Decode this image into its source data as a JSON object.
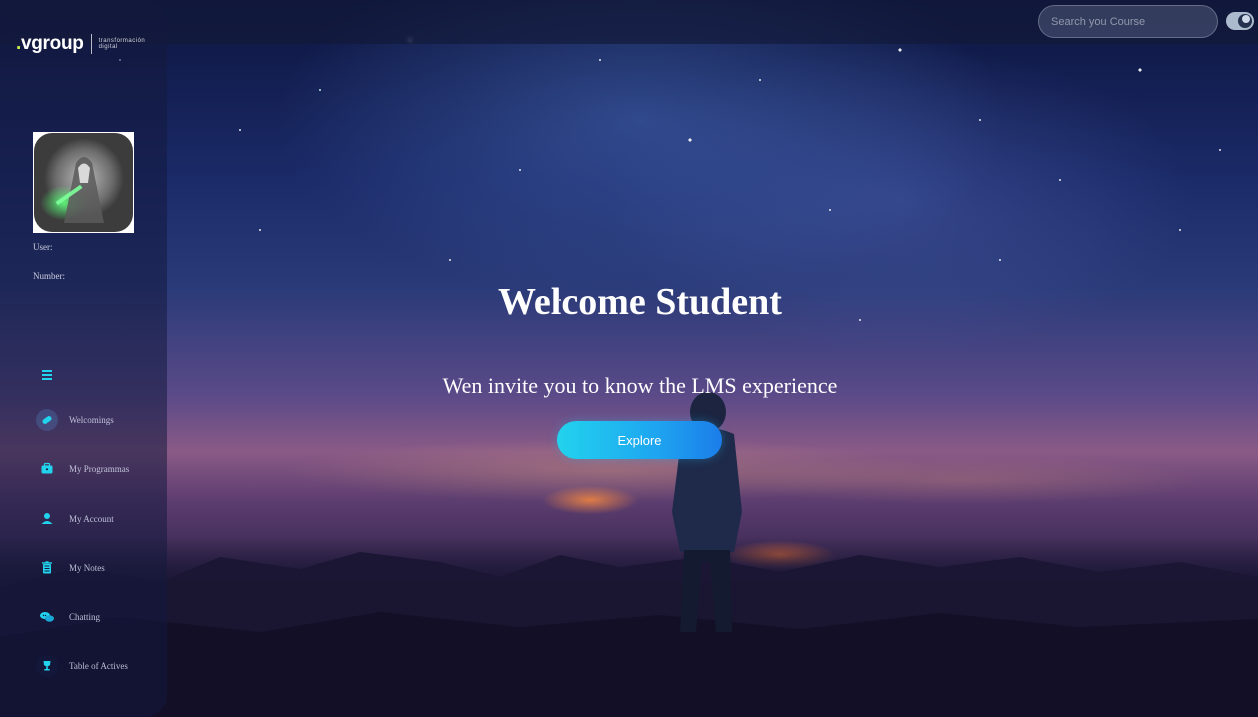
{
  "brand": {
    "logo_word": "vgroup",
    "logo_dot": ".",
    "logo_tagline": "transformación\ndigital"
  },
  "topbar": {
    "search_placeholder": "Search you Course"
  },
  "profile": {
    "user_label": "User:",
    "number_label": "Number:"
  },
  "sidebar": {
    "items": [
      {
        "label": "Welcomings",
        "icon": "pill-icon"
      },
      {
        "label": "My Programmas",
        "icon": "briefcase-icon"
      },
      {
        "label": "My Account",
        "icon": "person-icon"
      },
      {
        "label": "My Notes",
        "icon": "trash-note-icon"
      },
      {
        "label": "Chatting",
        "icon": "chat-bubbles-icon"
      },
      {
        "label": "Table of Actives",
        "icon": "trophy-icon"
      }
    ]
  },
  "hero": {
    "title": "Welcome Student",
    "subtitle": "Wen invite you to know the LMS experience",
    "button_label": "Explore"
  },
  "colors": {
    "accent": "#22d3ee",
    "accent_dark": "#1b7de9",
    "sidebar_bg": "#141a3e",
    "logo_dot": "#c8f24a"
  }
}
